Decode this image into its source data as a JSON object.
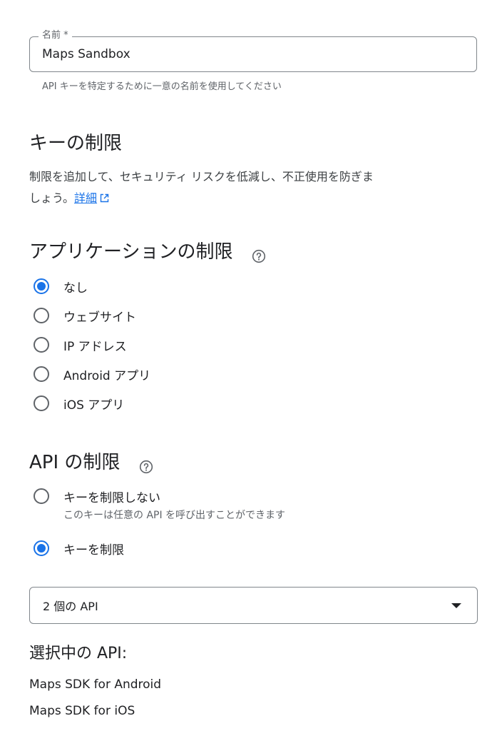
{
  "name_field": {
    "label": "名前 *",
    "value": "Maps Sandbox",
    "helper": "API キーを特定するために一意の名前を使用してください"
  },
  "key_restrictions": {
    "heading": "キーの制限",
    "description_line1": "制限を追加して、セキュリティ リスクを低減し、不正使用を防ぎま",
    "description_line2": "しょう。",
    "learn_more": "詳細"
  },
  "app_restrictions": {
    "heading": "アプリケーションの制限",
    "options": [
      {
        "label": "なし",
        "checked": true
      },
      {
        "label": "ウェブサイト",
        "checked": false
      },
      {
        "label": "IP アドレス",
        "checked": false
      },
      {
        "label": "Android アプリ",
        "checked": false
      },
      {
        "label": "iOS アプリ",
        "checked": false
      }
    ]
  },
  "api_restrictions": {
    "heading": "API の制限",
    "options": [
      {
        "label": "キーを制限しない",
        "sublabel": "このキーは任意の API を呼び出すことができます",
        "checked": false
      },
      {
        "label": "キーを制限",
        "checked": true
      }
    ],
    "select_value": "2 個の API",
    "selected_heading": "選択中の API:",
    "selected_apis": [
      "Maps SDK for Android",
      "Maps SDK for iOS"
    ]
  },
  "colors": {
    "accent": "#1a73e8",
    "text": "#202124",
    "secondary_text": "#5f6368",
    "border": "#80868b"
  },
  "icons": [
    "help-circle-icon",
    "external-link-icon",
    "dropdown-caret-icon"
  ]
}
